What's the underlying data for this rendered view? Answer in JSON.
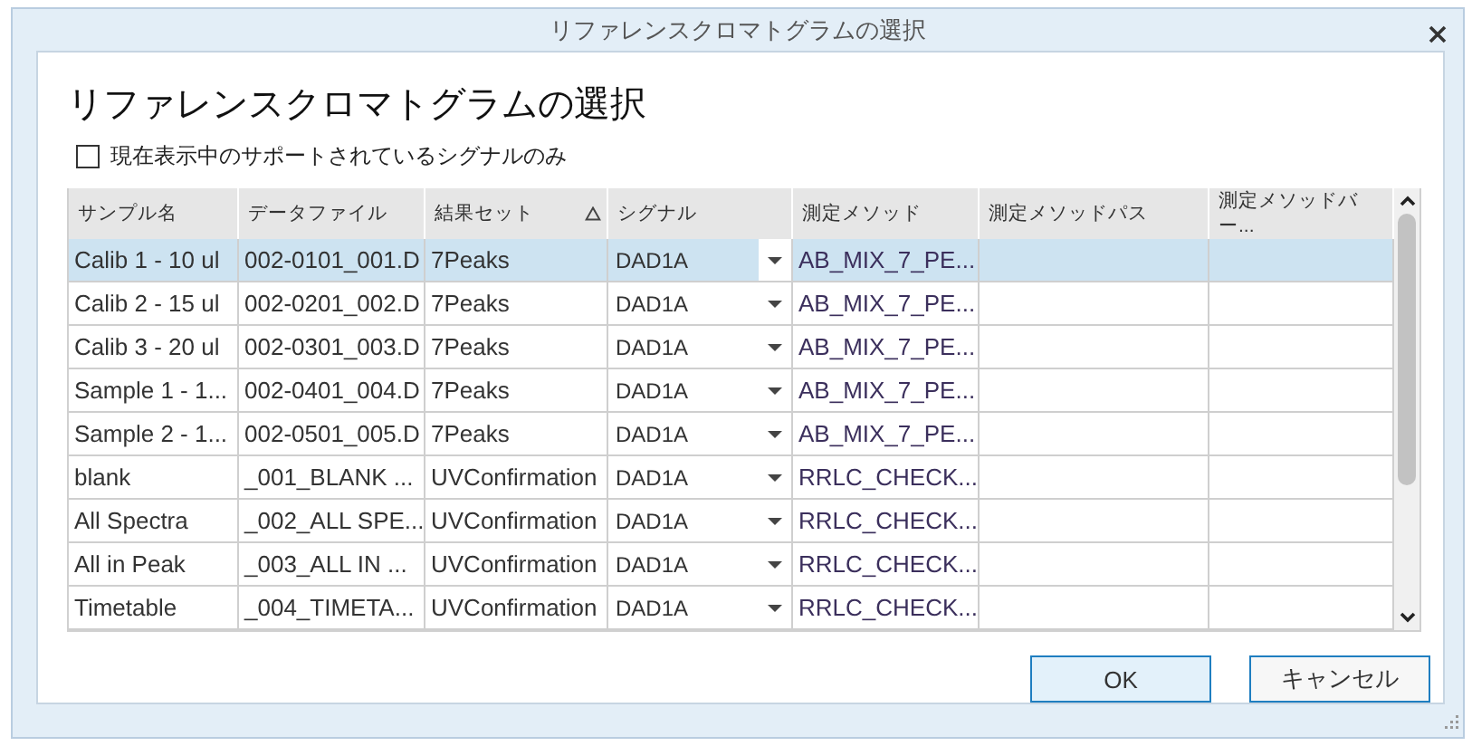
{
  "window": {
    "title": "リファレンスクロマトグラムの選択"
  },
  "heading": "リファレンスクロマトグラムの選択",
  "filter": {
    "label": "現在表示中のサポートされているシグナルのみ",
    "checked": false
  },
  "table": {
    "columns": [
      {
        "label": "サンプル名",
        "sorted": false
      },
      {
        "label": "データファイル",
        "sorted": false
      },
      {
        "label": "結果セット",
        "sorted": true
      },
      {
        "label": "シグナル",
        "sorted": false
      },
      {
        "label": "測定メソッド",
        "sorted": false
      },
      {
        "label": "測定メソッドパス",
        "sorted": false
      },
      {
        "label": "測定メソッドバー...",
        "sorted": false
      }
    ],
    "rows": [
      {
        "selected": true,
        "cells": [
          "Calib 1 - 10 ul",
          "002-0101_001.D",
          "7Peaks",
          "DAD1A",
          "AB_MIX_7_PE...",
          "",
          ""
        ]
      },
      {
        "selected": false,
        "cells": [
          "Calib 2 - 15 ul",
          "002-0201_002.D",
          "7Peaks",
          "DAD1A",
          "AB_MIX_7_PE...",
          "",
          ""
        ]
      },
      {
        "selected": false,
        "cells": [
          "Calib 3 - 20 ul",
          "002-0301_003.D",
          "7Peaks",
          "DAD1A",
          "AB_MIX_7_PE...",
          "",
          ""
        ]
      },
      {
        "selected": false,
        "cells": [
          "Sample 1 - 1...",
          "002-0401_004.D",
          "7Peaks",
          "DAD1A",
          "AB_MIX_7_PE...",
          "",
          ""
        ]
      },
      {
        "selected": false,
        "cells": [
          "Sample 2 - 1...",
          "002-0501_005.D",
          "7Peaks",
          "DAD1A",
          "AB_MIX_7_PE...",
          "",
          ""
        ]
      },
      {
        "selected": false,
        "cells": [
          "blank",
          "_001_BLANK ...",
          "UVConfirmation",
          "DAD1A",
          "RRLC_CHECK...",
          "",
          ""
        ]
      },
      {
        "selected": false,
        "cells": [
          "All Spectra",
          "_002_ALL SPE...",
          "UVConfirmation",
          "DAD1A",
          "RRLC_CHECK...",
          "",
          ""
        ]
      },
      {
        "selected": false,
        "cells": [
          "All in Peak",
          "_003_ALL IN ...",
          "UVConfirmation",
          "DAD1A",
          "RRLC_CHECK...",
          "",
          ""
        ]
      },
      {
        "selected": false,
        "cells": [
          "Timetable",
          "_004_TIMETA...",
          "UVConfirmation",
          "DAD1A",
          "RRLC_CHECK...",
          "",
          ""
        ]
      }
    ]
  },
  "buttons": [
    {
      "label": "OK",
      "kind": "default"
    },
    {
      "label": "キャンセル",
      "kind": "normal"
    }
  ]
}
